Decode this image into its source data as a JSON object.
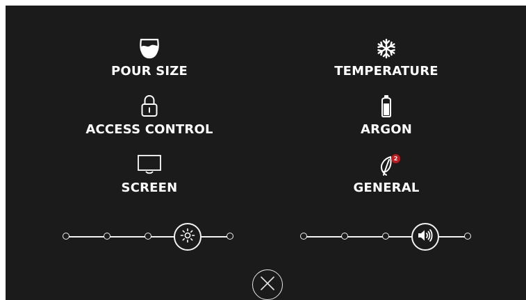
{
  "menu": {
    "pour_size": {
      "label": "POUR SIZE",
      "icon": "wine-glass-icon"
    },
    "temperature": {
      "label": "TEMPERATURE",
      "icon": "snowflake-icon"
    },
    "access_control": {
      "label": "ACCESS CONTROL",
      "icon": "padlock-icon"
    },
    "argon": {
      "label": "ARGON",
      "icon": "gas-cylinder-icon"
    },
    "screen": {
      "label": "SCREEN",
      "icon": "monitor-icon"
    },
    "general": {
      "label": "GENERAL",
      "icon": "leaf-icon",
      "badge": "2"
    }
  },
  "brightness_slider": {
    "steps": 5,
    "selected_step": 4,
    "icon": "sun-icon"
  },
  "volume_slider": {
    "steps": 5,
    "selected_step": 4,
    "icon": "speaker-icon"
  },
  "close_button": {
    "icon": "close-x-icon"
  },
  "colors": {
    "background": "#1b1b1b",
    "foreground": "#ffffff",
    "badge": "#c8161d"
  }
}
